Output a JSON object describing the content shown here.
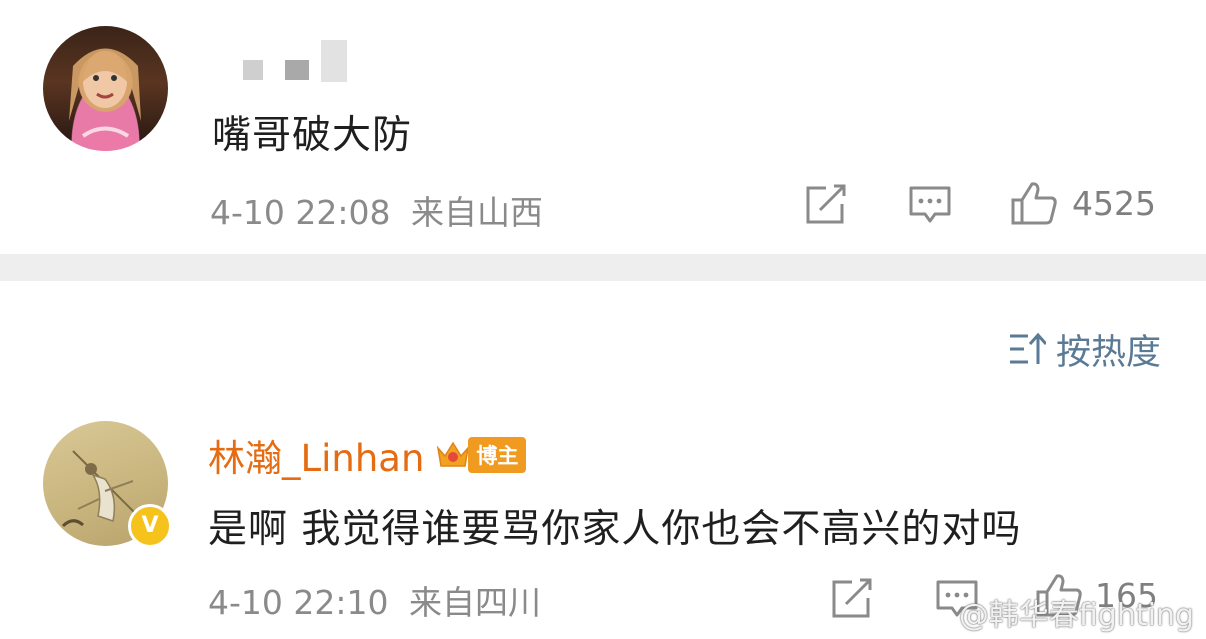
{
  "post1": {
    "avatar": "girl-avatar",
    "comment": "嘴哥破大防",
    "timestamp": "4-10 22:08",
    "location": "来自山西",
    "like_count": "4525"
  },
  "sort": {
    "label": "按热度",
    "icon": "sort-icon"
  },
  "post2": {
    "avatar": "illustration-avatar",
    "username": "林瀚_Linhan",
    "badge_label": "博主",
    "verified_mark": "V",
    "comment": "是啊 我觉得谁要骂你家人你也会不高兴的对吗",
    "timestamp": "4-10 22:10",
    "location": "来自四川",
    "like_count": "165"
  },
  "watermark": "@韩华春fighting",
  "colors": {
    "username": "#e56c12",
    "meta": "#8a8a8a",
    "sort": "#5a7a95",
    "divider": "#eeeeee",
    "badge": "#f09a20",
    "verified": "#f6c21c"
  }
}
